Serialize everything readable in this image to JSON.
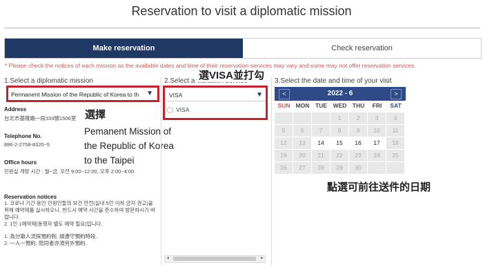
{
  "page_title": "Reservation to visit a diplomatic mission",
  "tabs": [
    {
      "label": "Make reservation",
      "active": true
    },
    {
      "label": "Check reservation",
      "active": false
    }
  ],
  "notice": "* Please check the notices of each mission as the available dates and time of their reservation services may vary and some may not offer reservation services.",
  "step1": {
    "label": "1.Select a diplomatic mission",
    "selected": "Permanent Mission of the Republic of Korea to th",
    "address_label": "Address",
    "address": "台北市基隆路一段333號1506室",
    "phone_label": "Telephone No.",
    "phone": "886-2-2758-8320~5",
    "hours_label": "Office hours",
    "hours": "민원실 개방 시간 : 월~금, 오전 9:00~12:00, 오후 2:00~4:00",
    "notices_label": "Reservation notices",
    "notices": [
      "1. 코로나 기간 동안 민원인들의 보건 안전(실내 5인 이하 금지 권고)을",
      "위해 예약제를 실시하오니, 반드시 예약 시간을 준수하여 방문하시기 바",
      "랍니다.",
      "2. 1인 1예약제(동행자 별도 예약 필요)입니다.",
      "",
      "1. 為分散人流採預約制, 請遵守預約時段.",
      "2. 一人一預約, 陪同者亦須另外預約."
    ]
  },
  "step2": {
    "label": "2.Select a visitation service",
    "selected": "VISA",
    "options": [
      "VISA"
    ]
  },
  "step3": {
    "label": "3.Select the date and time of your visit",
    "month": "2022 - 6",
    "prev": "<",
    "next": ">",
    "weekdays": [
      "SUN",
      "MON",
      "TUE",
      "WED",
      "THU",
      "FRI",
      "SAT"
    ],
    "weekday_colors": [
      "#d9534f",
      "#444444",
      "#444444",
      "#444444",
      "#444444",
      "#444444",
      "#2e4a87"
    ],
    "weeks": [
      [
        "",
        "",
        "",
        "1",
        "2",
        "3",
        "4"
      ],
      [
        "5",
        "6",
        "7",
        "8",
        "9",
        "10",
        "11"
      ],
      [
        "12",
        "13",
        "14",
        "15",
        "16",
        "17",
        "18"
      ],
      [
        "19",
        "20",
        "21",
        "22",
        "23",
        "24",
        "25"
      ],
      [
        "26",
        "27",
        "28",
        "29",
        "30",
        "",
        ""
      ]
    ],
    "enabled_days": [
      "14",
      "15",
      "16",
      "17"
    ]
  },
  "annotations": {
    "select": "選擇",
    "mission_en": [
      "Pemanent Mission of",
      "the Republic of Korea",
      "to the Taipei"
    ],
    "visa": "選VISA並打勾",
    "date": "點選可前往送件的日期"
  },
  "colors": {
    "header_blue": "#1f3864",
    "calendar_blue": "#2e4a87",
    "highlight_red": "#c7202b",
    "notice_red": "#d9534f"
  }
}
